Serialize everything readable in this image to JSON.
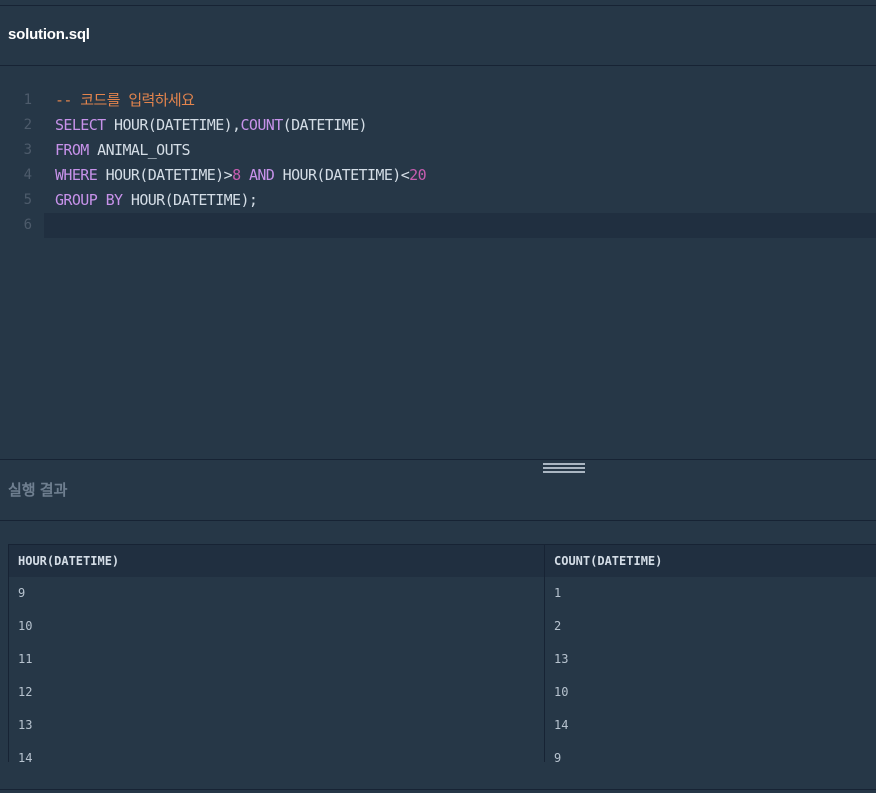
{
  "file_tab": {
    "title": "solution.sql"
  },
  "editor": {
    "lines": [
      {
        "no": "1",
        "tokens": [
          {
            "t": "-- 코드를 입력하세요",
            "k": "comment"
          }
        ]
      },
      {
        "no": "2",
        "tokens": [
          {
            "t": "SELECT",
            "k": "kw"
          },
          {
            "t": " HOUR(DATETIME),",
            "k": "plain"
          },
          {
            "t": "COUNT",
            "k": "kw"
          },
          {
            "t": "(DATETIME)",
            "k": "plain"
          }
        ]
      },
      {
        "no": "3",
        "tokens": [
          {
            "t": "FROM",
            "k": "kw"
          },
          {
            "t": " ANIMAL_OUTS",
            "k": "plain"
          }
        ]
      },
      {
        "no": "4",
        "tokens": [
          {
            "t": "WHERE",
            "k": "kw"
          },
          {
            "t": " HOUR(DATETIME)>",
            "k": "plain"
          },
          {
            "t": "8",
            "k": "num"
          },
          {
            "t": " ",
            "k": "plain"
          },
          {
            "t": "AND",
            "k": "kw"
          },
          {
            "t": " HOUR(DATETIME)<",
            "k": "plain"
          },
          {
            "t": "20",
            "k": "num"
          }
        ]
      },
      {
        "no": "5",
        "tokens": [
          {
            "t": "GROUP BY",
            "k": "kw"
          },
          {
            "t": " HOUR(DATETIME);",
            "k": "plain"
          }
        ]
      },
      {
        "no": "6",
        "tokens": []
      }
    ],
    "active_line": 6
  },
  "results": {
    "title": "실행 결과",
    "columns": [
      "HOUR(DATETIME)",
      "COUNT(DATETIME)"
    ],
    "rows": [
      [
        "9",
        "1"
      ],
      [
        "10",
        "2"
      ],
      [
        "11",
        "13"
      ],
      [
        "12",
        "10"
      ],
      [
        "13",
        "14"
      ],
      [
        "14",
        "9"
      ]
    ]
  },
  "colors": {
    "background": "#263747",
    "comment": "#e3844d",
    "keyword": "#c792ea",
    "number": "#c75db0",
    "text": "#d4dde6"
  }
}
